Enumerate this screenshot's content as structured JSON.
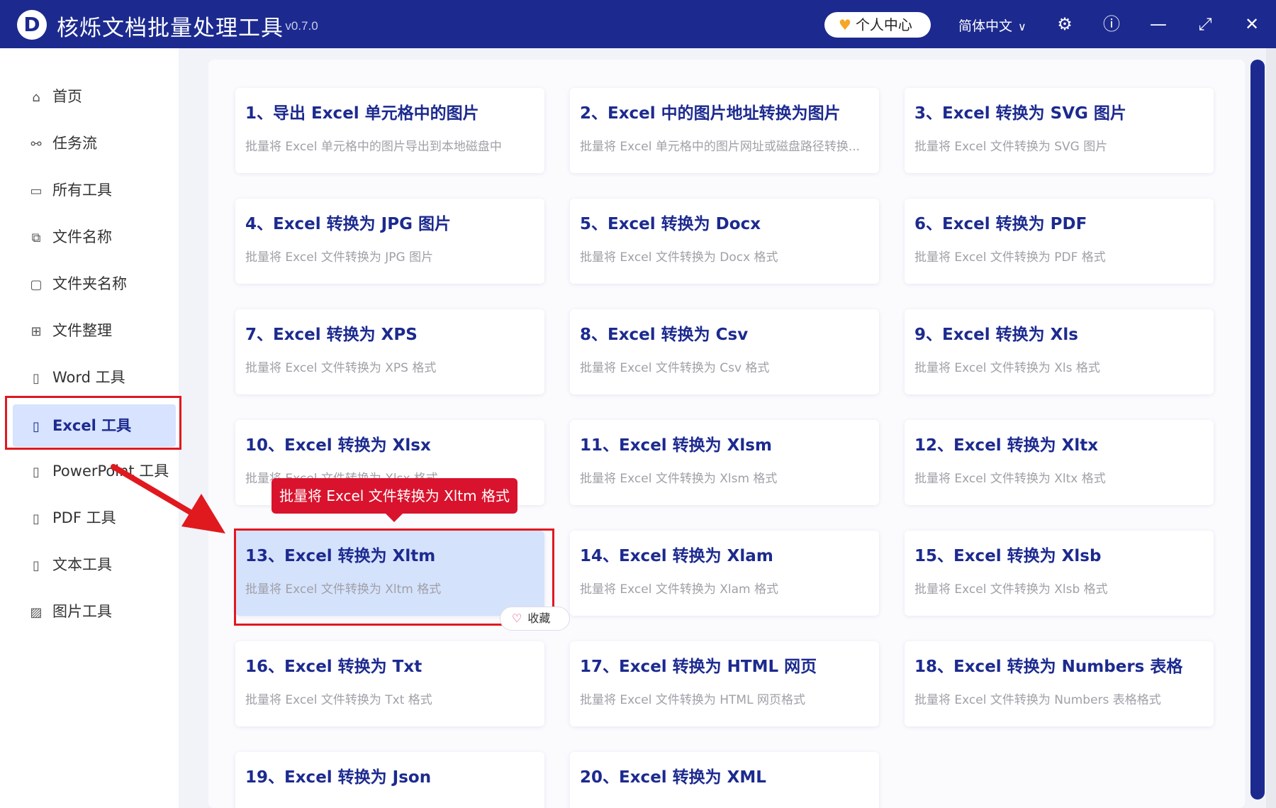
{
  "app": {
    "logo_letter": "D",
    "title": "核烁文档批量处理工具",
    "version": "- v0.7.0",
    "user_center": "个人中心",
    "language": "简体中文"
  },
  "sidebar": {
    "items": [
      {
        "label": "首页",
        "icon": "home-icon",
        "glyph": "⌂"
      },
      {
        "label": "任务流",
        "icon": "workflow-icon",
        "glyph": "⚯"
      },
      {
        "label": "所有工具",
        "icon": "monitor-icon",
        "glyph": "▭"
      },
      {
        "label": "文件名称",
        "icon": "file-copy-icon",
        "glyph": "⧉"
      },
      {
        "label": "文件夹名称",
        "icon": "folder-icon",
        "glyph": "▢"
      },
      {
        "label": "文件整理",
        "icon": "organize-icon",
        "glyph": "⊞"
      },
      {
        "label": "Word 工具",
        "icon": "word-file-icon",
        "glyph": "▯"
      },
      {
        "label": "Excel 工具",
        "icon": "excel-file-icon",
        "glyph": "▯"
      },
      {
        "label": "PowerPoint 工具",
        "icon": "ppt-file-icon",
        "glyph": "▯"
      },
      {
        "label": "PDF 工具",
        "icon": "pdf-file-icon",
        "glyph": "▯"
      },
      {
        "label": "文本工具",
        "icon": "text-file-icon",
        "glyph": "▯"
      },
      {
        "label": "图片工具",
        "icon": "image-icon",
        "glyph": "▨"
      }
    ],
    "active_index": 7
  },
  "tools": [
    {
      "title": "1、导出 Excel 单元格中的图片",
      "desc": "批量将 Excel 单元格中的图片导出到本地磁盘中"
    },
    {
      "title": "2、Excel 中的图片地址转换为图片",
      "desc": "批量将 Excel 单元格中的图片网址或磁盘路径转换..."
    },
    {
      "title": "3、Excel 转换为 SVG 图片",
      "desc": "批量将 Excel 文件转换为 SVG 图片"
    },
    {
      "title": "4、Excel 转换为 JPG 图片",
      "desc": "批量将 Excel 文件转换为 JPG 图片"
    },
    {
      "title": "5、Excel 转换为 Docx",
      "desc": "批量将 Excel 文件转换为 Docx 格式"
    },
    {
      "title": "6、Excel 转换为 PDF",
      "desc": "批量将 Excel 文件转换为 PDF 格式"
    },
    {
      "title": "7、Excel 转换为 XPS",
      "desc": "批量将 Excel 文件转换为 XPS 格式"
    },
    {
      "title": "8、Excel 转换为 Csv",
      "desc": "批量将 Excel 文件转换为 Csv 格式"
    },
    {
      "title": "9、Excel 转换为 Xls",
      "desc": "批量将 Excel 文件转换为 Xls 格式"
    },
    {
      "title": "10、Excel 转换为 Xlsx",
      "desc": "批量将 Excel 文件转换为 Xlsx 格式"
    },
    {
      "title": "11、Excel 转换为 Xlsm",
      "desc": "批量将 Excel 文件转换为 Xlsm 格式"
    },
    {
      "title": "12、Excel 转换为 Xltx",
      "desc": "批量将 Excel 文件转换为 Xltx 格式"
    },
    {
      "title": "13、Excel 转换为 Xltm",
      "desc": "批量将 Excel 文件转换为 Xltm 格式"
    },
    {
      "title": "14、Excel 转换为 Xlam",
      "desc": "批量将 Excel 文件转换为 Xlam 格式"
    },
    {
      "title": "15、Excel 转换为 Xlsb",
      "desc": "批量将 Excel 文件转换为 Xlsb 格式"
    },
    {
      "title": "16、Excel 转换为 Txt",
      "desc": "批量将 Excel 文件转换为 Txt 格式"
    },
    {
      "title": "17、Excel 转换为 HTML 网页",
      "desc": "批量将 Excel 文件转换为 HTML 网页格式"
    },
    {
      "title": "18、Excel 转换为 Numbers 表格",
      "desc": "批量将 Excel 文件转换为 Numbers 表格格式"
    },
    {
      "title": "19、Excel 转换为 Json",
      "desc": ""
    },
    {
      "title": "20、Excel 转换为 XML",
      "desc": ""
    }
  ],
  "selected_tool_index": 12,
  "tooltip": "批量将 Excel 文件转换为 Xltm 格式",
  "favorite_label": "收藏",
  "colors": {
    "brand": "#1c2a8f",
    "highlight": "#e0191f",
    "tooltip": "#d9132d",
    "selected_card": "#d5e2fb"
  }
}
